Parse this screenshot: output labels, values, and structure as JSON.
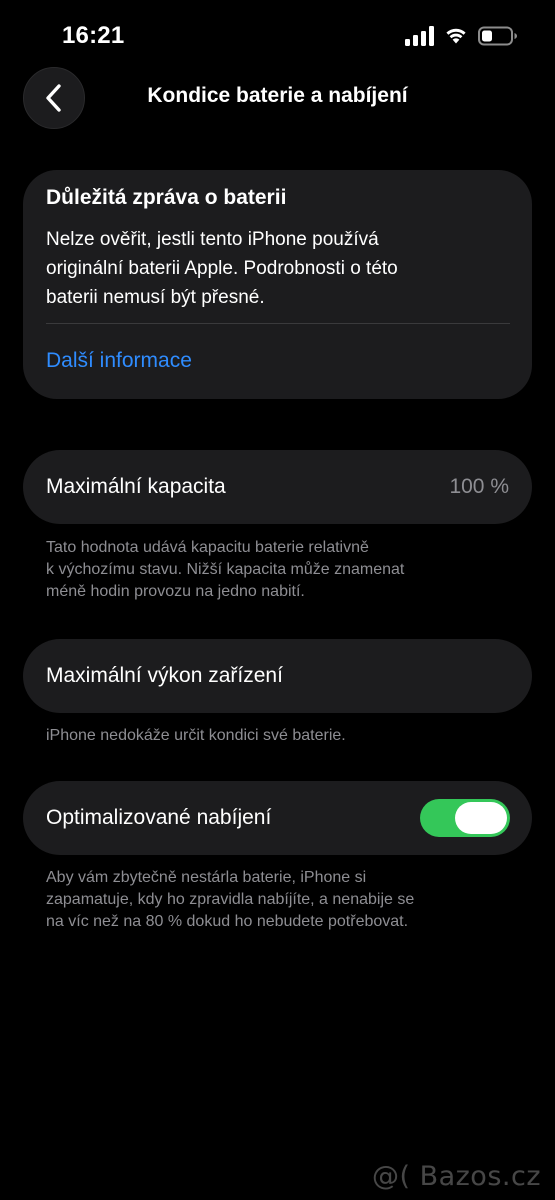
{
  "status_bar": {
    "time": "16:21",
    "icons": [
      "signal-icon",
      "wifi-icon",
      "battery-icon"
    ]
  },
  "nav": {
    "back_icon": "chevron-left-icon",
    "title": "Kondice baterie a nabíjení"
  },
  "alert_card": {
    "title": "Důležitá zpráva o baterii",
    "body_lines": [
      "Nelze ověřit, jestli tento iPhone používá",
      "originální baterii Apple. Podrobnosti o této",
      "baterii nemusí být přesné."
    ],
    "link": "Další informace"
  },
  "max_capacity": {
    "label": "Maximální kapacita",
    "value": "100 %",
    "footnote_lines": [
      "Tato hodnota udává kapacitu baterie relativně",
      "k výchozímu stavu. Nižší kapacita může znamenat",
      "méně hodin provozu na jedno nabití."
    ]
  },
  "peak_performance": {
    "label": "Maximální výkon zařízení",
    "footnote": "iPhone nedokáže určit kondici své baterie."
  },
  "optimized_charging": {
    "label": "Optimalizované nabíjení",
    "enabled": true,
    "footnote_lines": [
      "Aby vám zbytečně nestárla baterie, iPhone si",
      "zapamatuje, kdy ho zpravidla nabíjíte, a nenabije se",
      "na víc než na 80 % dokud ho nebudete potřebovat."
    ]
  },
  "watermark": "@( Bazos.cz",
  "colors": {
    "background": "#000000",
    "card": "#1c1c1e",
    "link": "#2f8cff",
    "toggle_on": "#34c759",
    "secondary_text": "#8e8e93"
  }
}
